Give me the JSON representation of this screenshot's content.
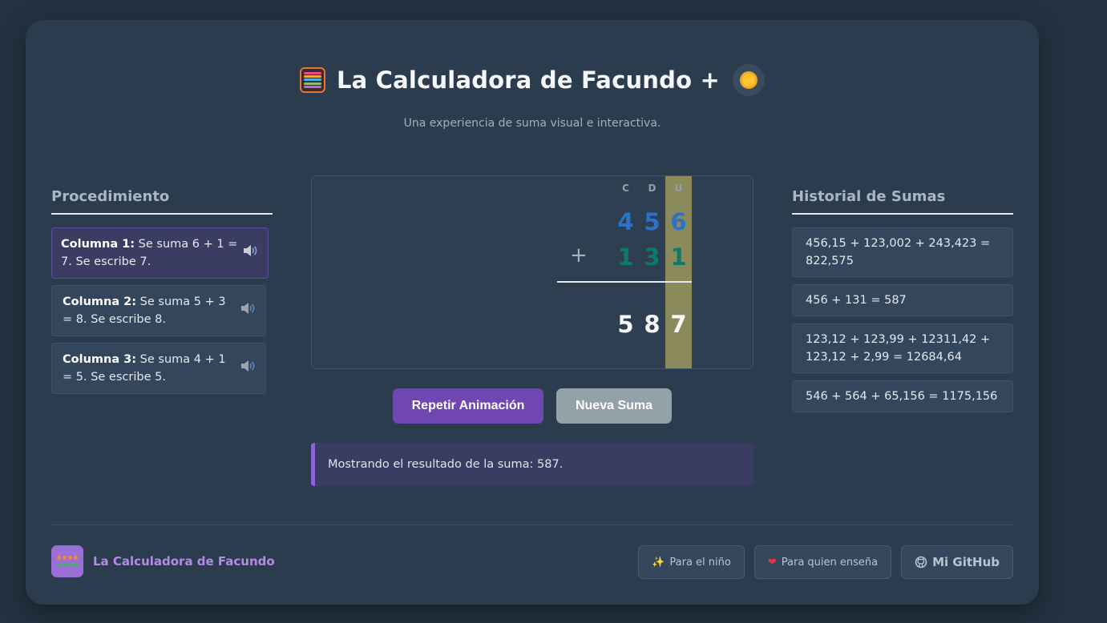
{
  "header": {
    "title": "La Calculadora de Facundo +",
    "subtitle": "Una experiencia de suma visual e interactiva.",
    "icon": "abacus-icon",
    "theme_toggle_icon": "sun-icon"
  },
  "procedure": {
    "title": "Procedimiento",
    "steps": [
      {
        "label": "Columna 1:",
        "text": " Se suma 6 + 1 = 7. Se escribe 7.",
        "active": true
      },
      {
        "label": "Columna 2:",
        "text": " Se suma 5 + 3 = 8. Se escribe 8.",
        "active": false
      },
      {
        "label": "Columna 3:",
        "text": " Se suma 4 + 1 = 5. Se escribe 5.",
        "active": false
      }
    ]
  },
  "board": {
    "column_labels": [
      "C",
      "D",
      "U"
    ],
    "highlighted_column": "U",
    "operand1": [
      "4",
      "5",
      "6"
    ],
    "operator": "+",
    "operand2": [
      "1",
      "3",
      "1"
    ],
    "result": [
      "5",
      "8",
      "7"
    ]
  },
  "buttons": {
    "repeat": "Repetir Animación",
    "new": "Nueva Suma"
  },
  "status": "Mostrando el resultado de la suma: 587.",
  "history": {
    "title": "Historial de Sumas",
    "items": [
      "456,15 + 123,002 + 243,423 = 822,575",
      "456 + 131 = 587",
      "123,12 + 123,99 + 12311,42 + 123,12 + 2,99 = 12684,64",
      "546 + 564 + 65,156 = 1175,156"
    ]
  },
  "footer": {
    "brand": "La Calculadora de Facundo",
    "links": [
      {
        "icon": "sparkles-icon",
        "label": "Para el niño"
      },
      {
        "icon": "heart-icon",
        "label": "Para quien enseña"
      },
      {
        "icon": "github-icon",
        "label": "Mi GitHub"
      }
    ]
  },
  "colors": {
    "accent": "#7046b2",
    "operand1": "#2c72c8",
    "operand2": "#0e7a6a",
    "highlight_column": "#8a8a5c"
  }
}
